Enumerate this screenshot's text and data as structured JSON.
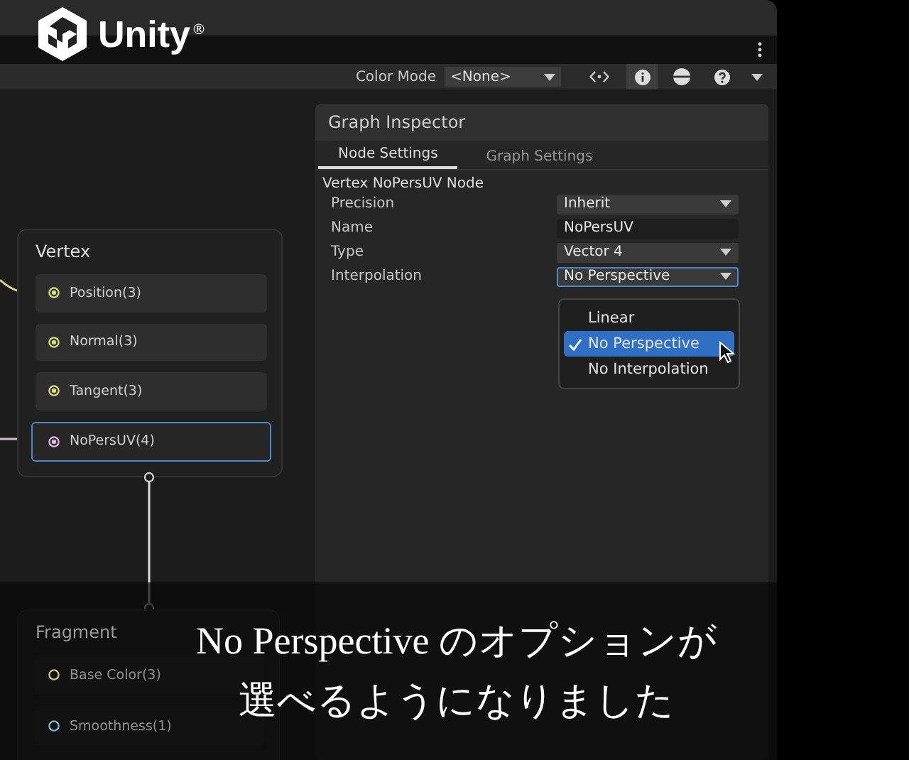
{
  "logo": {
    "text": "Unity",
    "mark": "®"
  },
  "toolbar": {
    "color_mode_label": "Color Mode",
    "color_mode_value": "<None>"
  },
  "inspector": {
    "title": "Graph Inspector",
    "tabs": [
      {
        "label": "Node Settings",
        "selected": true
      },
      {
        "label": "Graph Settings",
        "selected": false
      }
    ],
    "section_title": "Vertex NoPersUV Node",
    "properties": [
      {
        "label": "Precision",
        "kind": "dropdown",
        "value": "Inherit",
        "focused": false
      },
      {
        "label": "Name",
        "kind": "text",
        "value": "NoPersUV",
        "focused": false
      },
      {
        "label": "Type",
        "kind": "dropdown",
        "value": "Vector 4",
        "focused": false
      },
      {
        "label": "Interpolation",
        "kind": "dropdown",
        "value": "No Perspective",
        "focused": true
      }
    ],
    "dropdown_menu": {
      "options": [
        {
          "label": "Linear",
          "selected": false
        },
        {
          "label": "No Perspective",
          "selected": true
        },
        {
          "label": "No Interpolation",
          "selected": false
        }
      ]
    }
  },
  "vertex_node": {
    "title": "Vertex",
    "ports": [
      {
        "label": "Position(3)",
        "color": "#d6dc78",
        "selected": false
      },
      {
        "label": "Normal(3)",
        "color": "#d6dc78",
        "selected": false
      },
      {
        "label": "Tangent(3)",
        "color": "#d6dc78",
        "selected": false
      },
      {
        "label": "NoPersUV(4)",
        "color": "#e0b4e0",
        "selected": true
      }
    ]
  },
  "fragment_node": {
    "title": "Fragment",
    "ports": [
      {
        "label": "Base Color(3)",
        "color": "#c8c070",
        "selected": false
      },
      {
        "label": "Smoothness(1)",
        "color": "#70b4c0",
        "selected": false
      }
    ]
  },
  "subtitle": {
    "lines": [
      "No Perspective のオプションが",
      "選べるようになりました"
    ]
  }
}
